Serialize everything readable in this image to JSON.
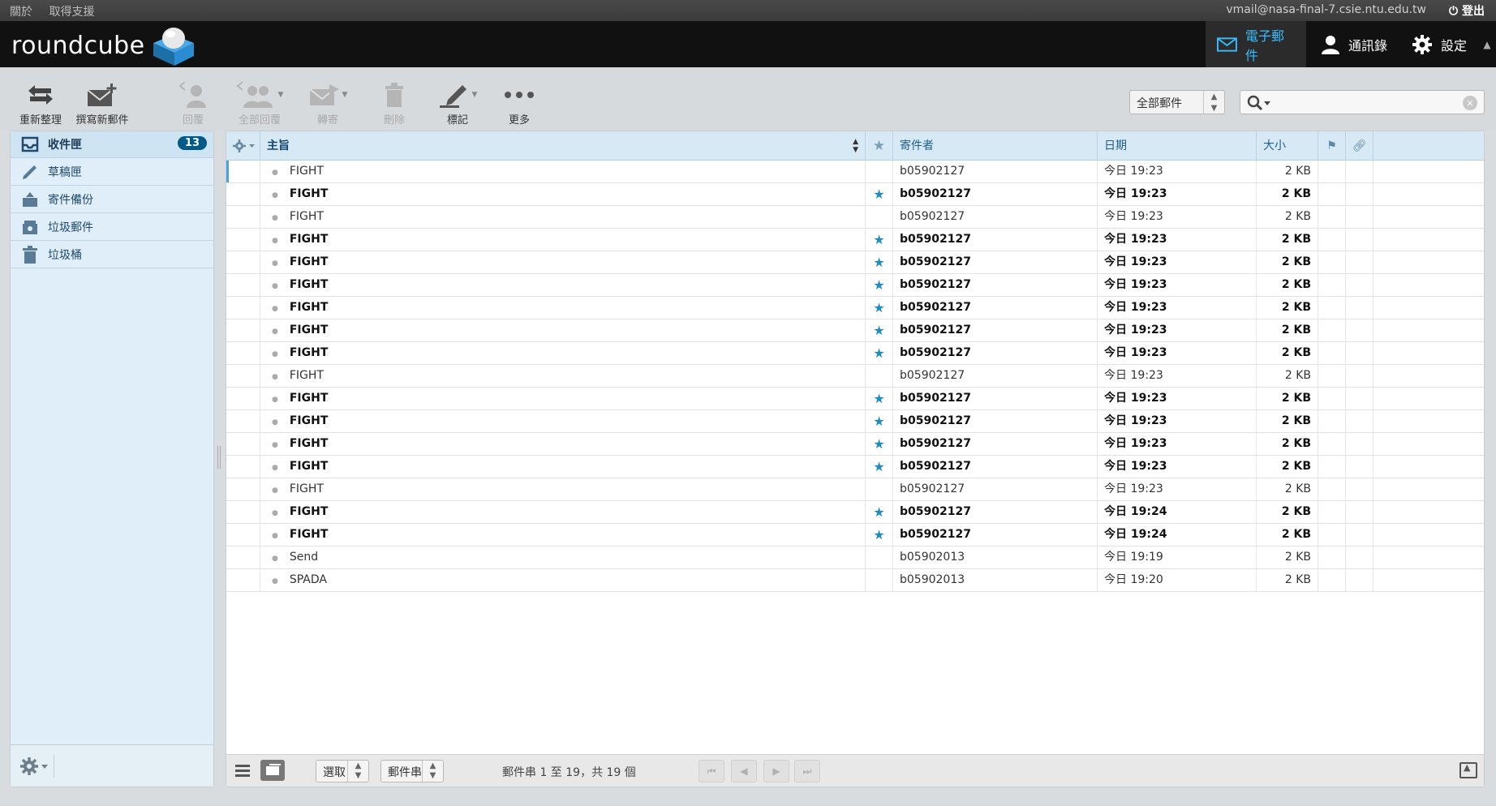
{
  "topline": {
    "about": "關於",
    "support": "取得支援",
    "email": "vmail@nasa-final-7.csie.ntu.edu.tw",
    "logout": "登出"
  },
  "header": {
    "logo_text": "roundcube",
    "tasks": {
      "mail": "電子郵件",
      "contacts": "通訊錄",
      "settings": "設定"
    }
  },
  "toolbar": {
    "refresh": "重新整理",
    "compose": "撰寫新郵件",
    "reply": "回覆",
    "reply_all": "全部回覆",
    "forward": "轉寄",
    "delete": "刪除",
    "mark": "標記",
    "more": "更多",
    "filter": "全部郵件",
    "search_placeholder": ""
  },
  "folders": [
    {
      "label": "收件匣",
      "unread": "13",
      "icon": "inbox-icon"
    },
    {
      "label": "草稿匣",
      "icon": "pencil-icon"
    },
    {
      "label": "寄件備份",
      "icon": "sent-icon"
    },
    {
      "label": "垃圾郵件",
      "icon": "junk-icon"
    },
    {
      "label": "垃圾桶",
      "icon": "trash-icon"
    }
  ],
  "list": {
    "columns": {
      "subject": "主旨",
      "from": "寄件者",
      "date": "日期",
      "size": "大小"
    },
    "messages": [
      {
        "subject": "FIGHT",
        "from": "b05902127",
        "date": "今日 19:23",
        "size": "2 KB",
        "unread": false
      },
      {
        "subject": "FIGHT",
        "from": "b05902127",
        "date": "今日 19:23",
        "size": "2 KB",
        "unread": true
      },
      {
        "subject": "FIGHT",
        "from": "b05902127",
        "date": "今日 19:23",
        "size": "2 KB",
        "unread": false
      },
      {
        "subject": "FIGHT",
        "from": "b05902127",
        "date": "今日 19:23",
        "size": "2 KB",
        "unread": true
      },
      {
        "subject": "FIGHT",
        "from": "b05902127",
        "date": "今日 19:23",
        "size": "2 KB",
        "unread": true
      },
      {
        "subject": "FIGHT",
        "from": "b05902127",
        "date": "今日 19:23",
        "size": "2 KB",
        "unread": true
      },
      {
        "subject": "FIGHT",
        "from": "b05902127",
        "date": "今日 19:23",
        "size": "2 KB",
        "unread": true
      },
      {
        "subject": "FIGHT",
        "from": "b05902127",
        "date": "今日 19:23",
        "size": "2 KB",
        "unread": true
      },
      {
        "subject": "FIGHT",
        "from": "b05902127",
        "date": "今日 19:23",
        "size": "2 KB",
        "unread": true
      },
      {
        "subject": "FIGHT",
        "from": "b05902127",
        "date": "今日 19:23",
        "size": "2 KB",
        "unread": false
      },
      {
        "subject": "FIGHT",
        "from": "b05902127",
        "date": "今日 19:23",
        "size": "2 KB",
        "unread": true
      },
      {
        "subject": "FIGHT",
        "from": "b05902127",
        "date": "今日 19:23",
        "size": "2 KB",
        "unread": true
      },
      {
        "subject": "FIGHT",
        "from": "b05902127",
        "date": "今日 19:23",
        "size": "2 KB",
        "unread": true
      },
      {
        "subject": "FIGHT",
        "from": "b05902127",
        "date": "今日 19:23",
        "size": "2 KB",
        "unread": true
      },
      {
        "subject": "FIGHT",
        "from": "b05902127",
        "date": "今日 19:23",
        "size": "2 KB",
        "unread": false
      },
      {
        "subject": "FIGHT",
        "from": "b05902127",
        "date": "今日 19:24",
        "size": "2 KB",
        "unread": true
      },
      {
        "subject": "FIGHT",
        "from": "b05902127",
        "date": "今日 19:24",
        "size": "2 KB",
        "unread": true
      },
      {
        "subject": "Send",
        "from": "b05902013",
        "date": "今日 19:19",
        "size": "2 KB",
        "unread": false
      },
      {
        "subject": "SPADA",
        "from": "b05902013",
        "date": "今日 19:20",
        "size": "2 KB",
        "unread": false
      }
    ]
  },
  "footer": {
    "select": "選取",
    "threads": "郵件串",
    "count": "郵件串 1 至 19，共 19 個"
  },
  "colors": {
    "accent": "#37beff",
    "star": "#1f8cc6",
    "badge": "#005a87"
  }
}
